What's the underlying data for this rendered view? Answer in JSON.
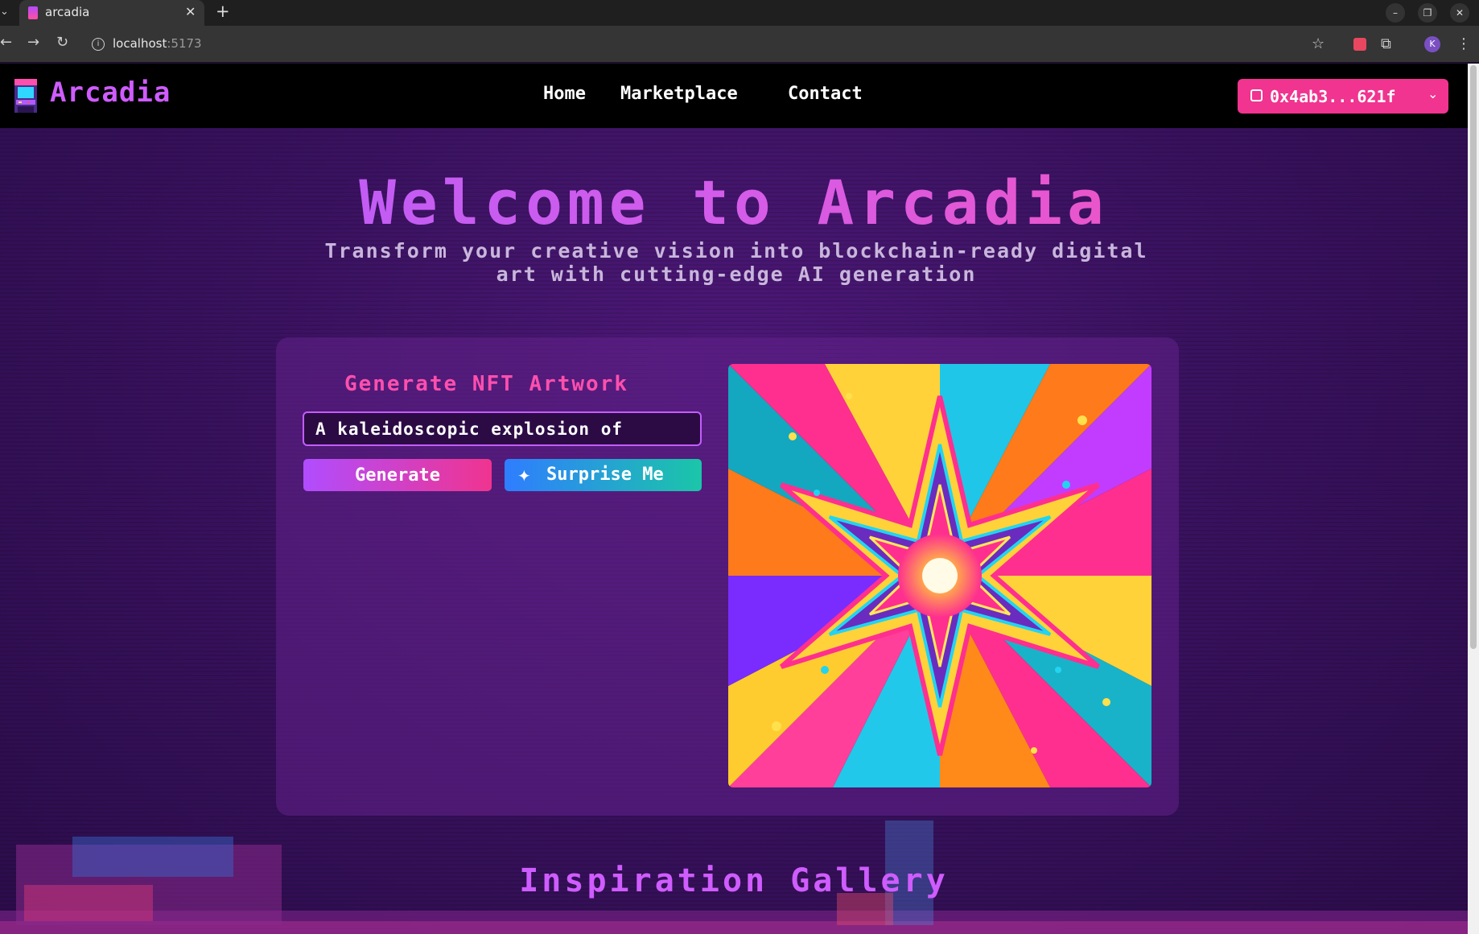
{
  "browser": {
    "tab_title": "arcadia",
    "url_host": "localhost",
    "url_port": ":5173",
    "profile_initial": "K"
  },
  "header": {
    "logo_text": "Arcadia",
    "nav": [
      "Home",
      "Marketplace",
      "Contact"
    ],
    "wallet_address": "0x4ab3...621f"
  },
  "hero": {
    "title": "Welcome to Arcadia",
    "subtitle": "Transform your creative vision into blockchain-ready digital art with cutting-edge AI generation"
  },
  "generator": {
    "title": "Generate NFT Artwork",
    "prompt_value": "A kaleidoscopic explosion of",
    "generate_label": "Generate",
    "surprise_label": "Surprise Me"
  },
  "gallery": {
    "title": "Inspiration Gallery"
  },
  "colors": {
    "brand_purple": "#cf5cff",
    "brand_pink": "#f0348f",
    "background": "#3a1260"
  }
}
